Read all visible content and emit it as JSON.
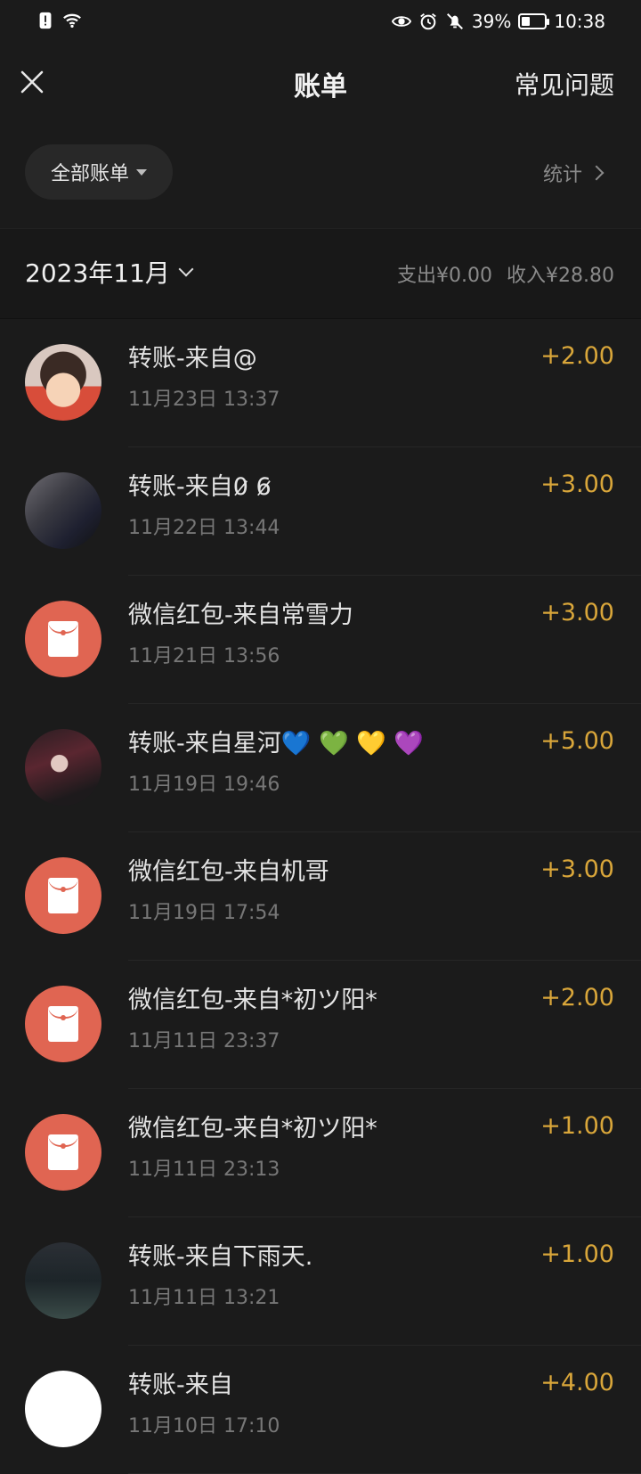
{
  "status_bar": {
    "battery_percent": "39%",
    "time": "10:38",
    "battery_level": 0.39,
    "icons": [
      "sim-alert-icon",
      "wifi-icon",
      "eye-icon",
      "alarm-icon",
      "mute-icon",
      "battery-icon"
    ]
  },
  "header": {
    "close_icon": "close-icon",
    "title": "账单",
    "faq_label": "常见问题"
  },
  "filter": {
    "all_bills_label": "全部账单",
    "stats_label": "统计"
  },
  "month_bar": {
    "month": "2023年11月",
    "expense": "支出¥0.00",
    "income": "收入¥28.80"
  },
  "transactions": [
    {
      "name": "转账-来自@",
      "time": "11月23日 13:37",
      "amount": "+2.00",
      "avatar": "photo1"
    },
    {
      "name": "转账-来自0̷ 6̷",
      "time": "11月22日 13:44",
      "amount": "+3.00",
      "avatar": "photo2"
    },
    {
      "name": "微信红包-来自常雪力",
      "time": "11月21日 13:56",
      "amount": "+3.00",
      "avatar": "redpacket"
    },
    {
      "name": "转账-来自星河💙 💚 💛 💜",
      "time": "11月19日 19:46",
      "amount": "+5.00",
      "avatar": "photo3"
    },
    {
      "name": "微信红包-来自机哥",
      "time": "11月19日 17:54",
      "amount": "+3.00",
      "avatar": "redpacket"
    },
    {
      "name": "微信红包-来自*初ツ阳*",
      "time": "11月11日 23:37",
      "amount": "+2.00",
      "avatar": "redpacket"
    },
    {
      "name": "微信红包-来自*初ツ阳*",
      "time": "11月11日 23:13",
      "amount": "+1.00",
      "avatar": "redpacket"
    },
    {
      "name": "转账-来自下雨天.",
      "time": "11月11日 13:21",
      "amount": "+1.00",
      "avatar": "photo4"
    },
    {
      "name": "转账-来自",
      "time": "11月10日 17:10",
      "amount": "+4.00",
      "avatar": "white"
    }
  ],
  "colors": {
    "background": "#1b1b1b",
    "amount": "#d9a63a",
    "red_packet": "#e06552"
  }
}
